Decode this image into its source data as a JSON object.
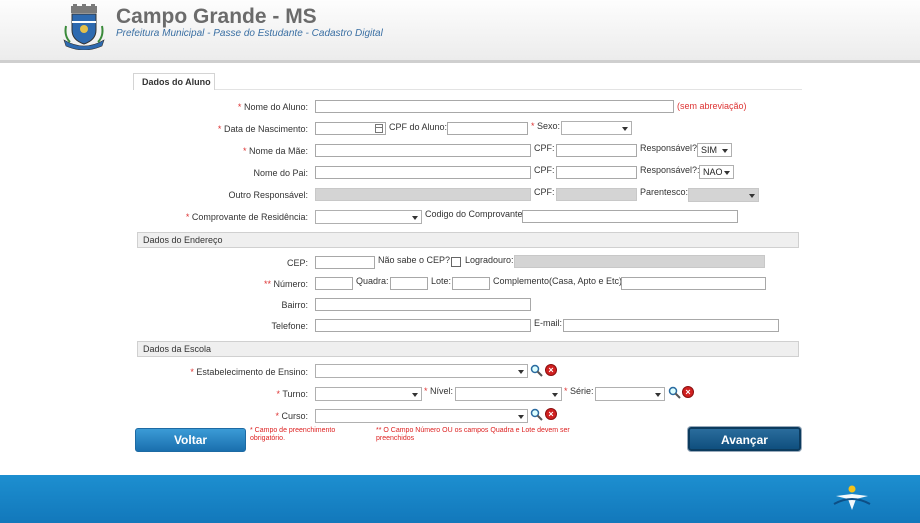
{
  "header": {
    "title": "Campo Grande - MS",
    "subtitle": "Prefeitura Municipal - Passe do Estudante - Cadastro Digital"
  },
  "tab": {
    "label": "Dados do Aluno"
  },
  "aluno": {
    "nome_label": "Nome do Aluno:",
    "sem_abreviacao": "(sem abreviação)",
    "nascimento_label": "Data de Nascimento:",
    "cpf_aluno_label": "CPF do Aluno:",
    "sexo_label": "Sexo:",
    "mae_label": "Nome da Mãe:",
    "cpf_label": "CPF:",
    "responsavel_label": "Responsável?",
    "responsavel_mae_value": "SIM",
    "pai_label": "Nome do Pai:",
    "responsavel_pai_label": "Responsável?:",
    "responsavel_pai_value": "NAO",
    "outro_label": "Outro Responsável:",
    "parentesco_label": "Parentesco:",
    "comprovante_label": "Comprovante de Residência:",
    "codigo_label": "Codigo do Comprovante:"
  },
  "endereco": {
    "section": "Dados do Endereço",
    "cep_label": "CEP:",
    "nao_sabe_label": "Não sabe o CEP?",
    "logradouro_label": "Logradouro:",
    "numero_label": "Número:",
    "quadra_label": "Quadra:",
    "lote_label": "Lote:",
    "complemento_label": "Complemento(Casa, Apto e Etc):",
    "bairro_label": "Bairro:",
    "telefone_label": "Telefone:",
    "email_label": "E-mail:"
  },
  "escola": {
    "section": "Dados da Escola",
    "estabelecimento_label": "Estabelecimento de Ensino:",
    "turno_label": "Turno:",
    "nivel_label": "Nível:",
    "serie_label": "Série:",
    "curso_label": "Curso:"
  },
  "markers": {
    "single": "*",
    "double": "**"
  },
  "notes": {
    "required": "* Campo de preenchimento obrigatório.",
    "numero": "** O Campo Número OU os campos Quadra e Lote devem ser preenchidos"
  },
  "buttons": {
    "voltar": "Voltar",
    "avancar": "Avançar"
  },
  "colors": {
    "accent": "#1278bb",
    "required": "#d33333",
    "header_title": "#6b6b6b"
  }
}
